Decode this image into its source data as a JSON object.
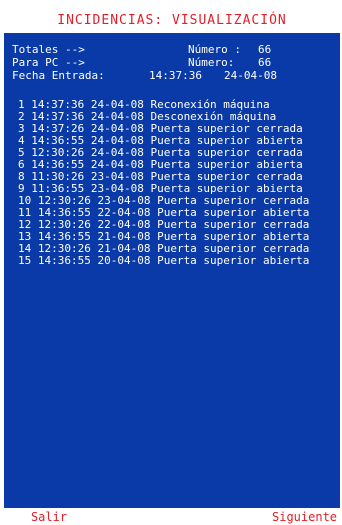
{
  "title": "INCIDENCIAS: VISUALIZACIÓN",
  "summary": {
    "totales_label": "Totales -->",
    "totales_num_label": "Número :",
    "totales_num_value": "66",
    "pc_label": "Para PC -->",
    "pc_num_label": "Número:",
    "pc_num_value": "66",
    "fecha_label": "Fecha Entrada:",
    "fecha_time": "14:37:36",
    "fecha_date": "24-04-08"
  },
  "events": [
    "1 14:37:36 24-04-08 Reconexión máquina",
    "2 14:37:36 24-04-08 Desconexión máquina",
    "3 14:37:26 24-04-08 Puerta superior cerrada",
    "4 14:36:55 24-04-08 Puerta superior abierta",
    "5 12:30:26 24-04-08 Puerta superior cerrada",
    "6 14:36:55 24-04-08 Puerta superior abierta",
    "8 11:30:26 23-04-08 Puerta superior cerrada",
    "9 11:36:55 23-04-08 Puerta superior abierta",
    "10 12:30:26 23-04-08 Puerta superior cerrada",
    "11 14:36:55 22-04-08 Puerta superior abierta",
    "12 12:30:26 22-04-08 Puerta superior cerrada",
    "13 14:36:55 21-04-08 Puerta superior abierta",
    "14 12:30:26 21-04-08 Puerta superior cerrada",
    "15 14:36:55 20-04-08 Puerta superior abierta"
  ],
  "buttons": {
    "exit": "Salir",
    "next": "Siguiente"
  },
  "colors": {
    "background": "#0a3aa8",
    "text": "#ffffff",
    "accent": "#e11f28"
  }
}
